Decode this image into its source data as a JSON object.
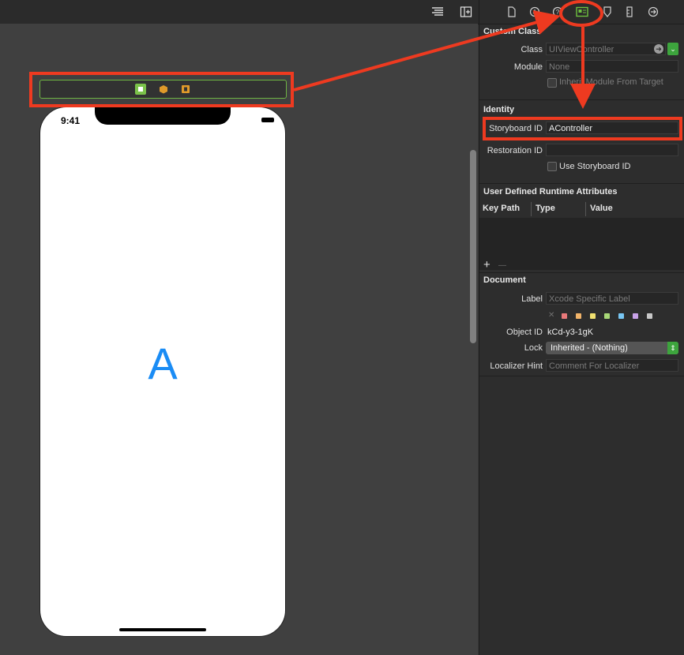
{
  "phone": {
    "time": "9:41",
    "center_label": "A"
  },
  "inspector": {
    "custom_class": {
      "title": "Custom Class",
      "class_label": "Class",
      "class_placeholder": "UIViewController",
      "module_label": "Module",
      "module_placeholder": "None",
      "inherit_label": "Inherit Module From Target"
    },
    "identity": {
      "title": "Identity",
      "storyboard_id_label": "Storyboard ID",
      "storyboard_id_value": "AController",
      "restoration_id_label": "Restoration ID",
      "restoration_id_value": "",
      "use_storyboard_label": "Use Storyboard ID"
    },
    "runtime_attrs": {
      "title": "User Defined Runtime Attributes",
      "col_key_path": "Key Path",
      "col_type": "Type",
      "col_value": "Value",
      "add": "+",
      "remove": "—"
    },
    "document": {
      "title": "Document",
      "label_label": "Label",
      "label_placeholder": "Xcode Specific Label",
      "clear_color": "✕",
      "object_id_label": "Object ID",
      "object_id_value": "kCd-y3-1gK",
      "lock_label": "Lock",
      "lock_value": "Inherited - (Nothing)",
      "localizer_hint_label": "Localizer Hint",
      "localizer_hint_placeholder": "Comment For Localizer"
    }
  },
  "colors": {
    "accent_green": "#6ec13f",
    "annotation_red": "#ee3a20",
    "label_blue": "#1a8cf5",
    "swatches": [
      "#e8797a",
      "#f2b46a",
      "#f0e070",
      "#a8d877",
      "#78c6f2",
      "#c8a2e8",
      "#c8c8c8"
    ]
  },
  "icons": {
    "toolbar": [
      "align-lines-icon",
      "add-panel-icon"
    ],
    "inspector_tabs": [
      "file-icon",
      "history-icon",
      "help-icon",
      "identity-inspector-icon",
      "attributes-icon",
      "size-ruler-icon",
      "connections-icon"
    ],
    "scene_bar": [
      "view-controller-icon",
      "first-responder-icon",
      "exit-icon"
    ]
  }
}
